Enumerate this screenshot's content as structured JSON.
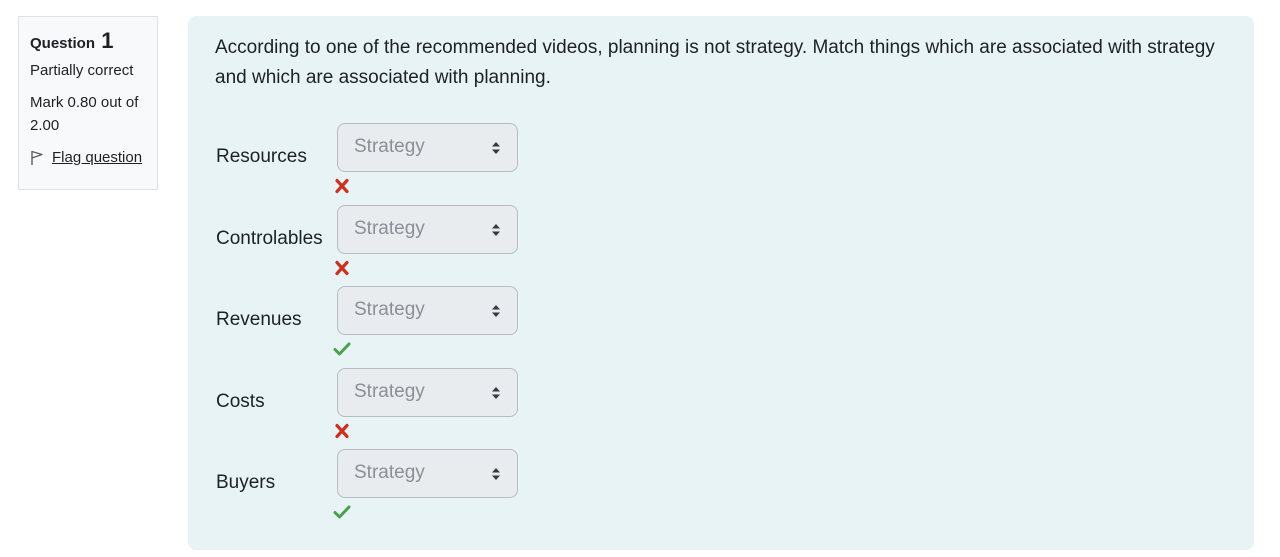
{
  "info": {
    "question_label": "Question",
    "question_number": "1",
    "state": "Partially correct",
    "grade": "Mark 0.80 out of 2.00",
    "flag_label": "Flag question"
  },
  "question": {
    "text": "According to one of the recommended videos, planning is not strategy. Match things which are associated with strategy and which are associated with planning."
  },
  "rows": [
    {
      "label": "Resources",
      "selected": "Strategy",
      "result": "incorrect"
    },
    {
      "label": "Controlables",
      "selected": "Strategy",
      "result": "incorrect"
    },
    {
      "label": "Revenues",
      "selected": "Strategy",
      "result": "correct"
    },
    {
      "label": "Costs",
      "selected": "Strategy",
      "result": "incorrect"
    },
    {
      "label": "Buyers",
      "selected": "Strategy",
      "result": "correct"
    }
  ],
  "colors": {
    "correct": "#4aa14a",
    "incorrect": "#ca3120",
    "panel": "#e7f3f5"
  }
}
